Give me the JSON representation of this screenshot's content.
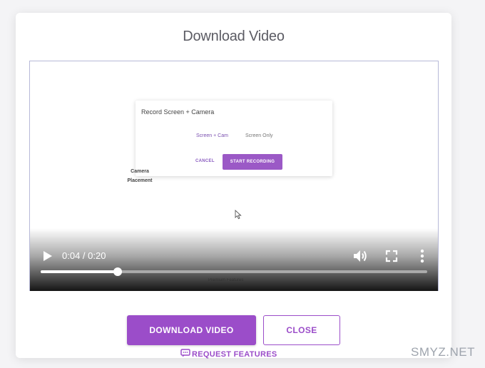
{
  "modal": {
    "title": "Download Video"
  },
  "video_frame": {
    "card_title": "Record Screen + Camera",
    "option_screen_cam": "Screen + Cam",
    "option_screen_only": "Screen Only",
    "cancel_label": "CANCEL",
    "start_label": "START RECORDING",
    "camera_label": "Camera",
    "placement_label": "Placement",
    "bottom_text": "Premium Features"
  },
  "player": {
    "time_display": "0:04 / 0:20",
    "progress_fraction": 0.2,
    "icons": [
      "play-icon",
      "volume-icon",
      "fullscreen-icon",
      "more-options-icon"
    ]
  },
  "actions": {
    "download_label": "DOWNLOAD VIDEO",
    "close_label": "CLOSE",
    "request_label": "REQUEST FEATURES"
  },
  "watermark": "SMYZ.NET",
  "colors": {
    "accent": "#9b4dc9",
    "title_text": "#5b5b63",
    "background": "#f4f4f6"
  }
}
